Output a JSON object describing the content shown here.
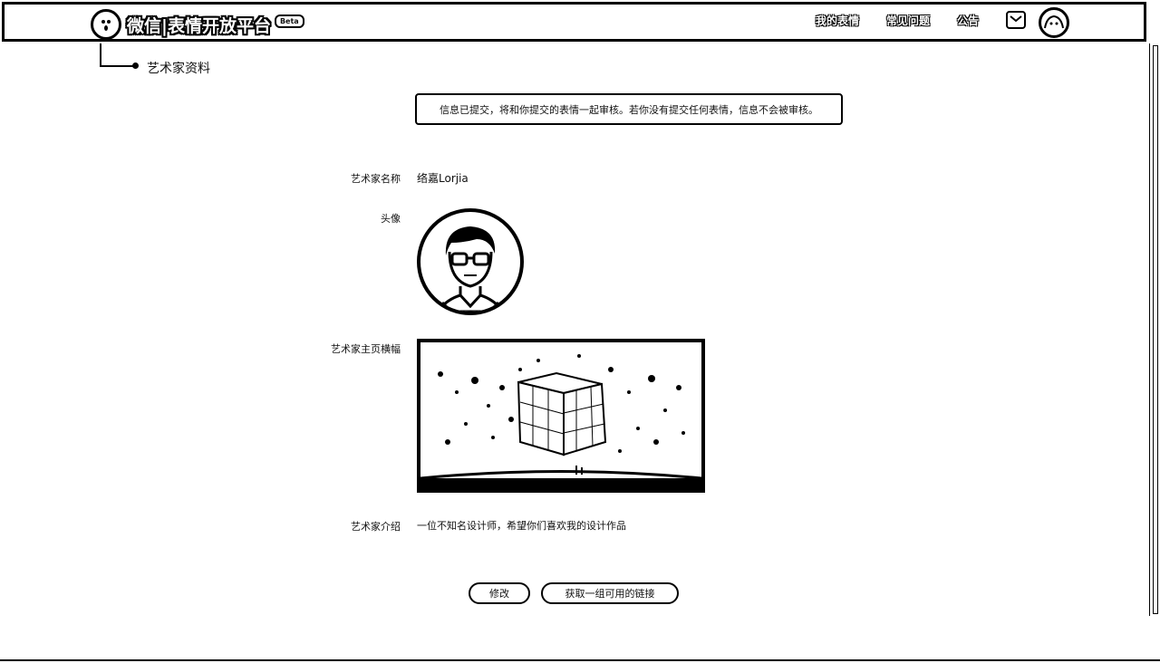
{
  "header": {
    "brand_title": "微信|表情开放平台",
    "beta": "Beta",
    "nav": {
      "my_stickers": "我的表情",
      "faq": "常见问题",
      "announcement": "公告"
    }
  },
  "breadcrumb": {
    "current": "艺术家资料"
  },
  "notice": "信息已提交，将和你提交的表情一起审核。若你没有提交任何表情，信息不会被审核。",
  "form": {
    "name_label": "艺术家名称",
    "name_value": "络嘉Lorjia",
    "avatar_label": "头像",
    "banner_label": "艺术家主页横幅",
    "intro_label": "艺术家介绍",
    "intro_value": "一位不知名设计师，希望你们喜欢我的设计作品"
  },
  "actions": {
    "edit": "修改",
    "get_link": "获取一组可用的链接"
  }
}
